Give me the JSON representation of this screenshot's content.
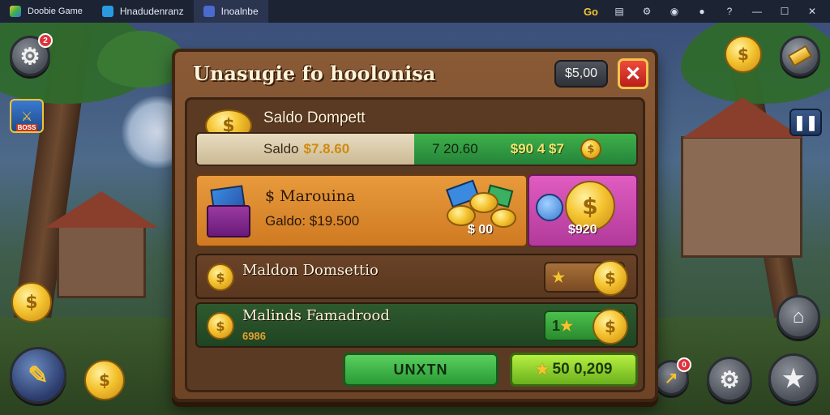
{
  "emulator": {
    "app_name": "Doobie Game",
    "tab_1": "Hnadudenranz",
    "tab_2": "Inoalnbe",
    "tray_label": "Go"
  },
  "dialog": {
    "title": "Unasugie fo hoolonisa",
    "price_chip": "5,00",
    "close_label": "✕"
  },
  "wallet": {
    "title": "Saldo Dompett",
    "balance_label": "Saldo",
    "balance_value": "$7.8.60",
    "amount_1": "7 20.60",
    "amount_2": "$90 4 $7",
    "coin_glyph": "$"
  },
  "offer_marquina": {
    "title": "$ Marouina",
    "balance": "Galdo: $19.500",
    "price": "$ 00"
  },
  "offer_pink": {
    "price": "$920"
  },
  "rows": [
    {
      "title": "Maldon Domsettio",
      "sub": ""
    },
    {
      "title": "Malinds Famadrood",
      "sub": "6986",
      "action_count": "1"
    }
  ],
  "buttons": {
    "primary": "UNXTN",
    "secondary": "50 0,209"
  },
  "hud": {
    "settings_badge": "2",
    "bottom_right_badge": "0",
    "item_label": "BOSS"
  },
  "colors": {
    "panel": "#8a5a36",
    "wallet_green": "#3fb04a",
    "offer_orange": "#e89a3c",
    "offer_pink": "#e05cc0",
    "close_red": "#f04a3c",
    "coin_gold": "#f5c431"
  }
}
